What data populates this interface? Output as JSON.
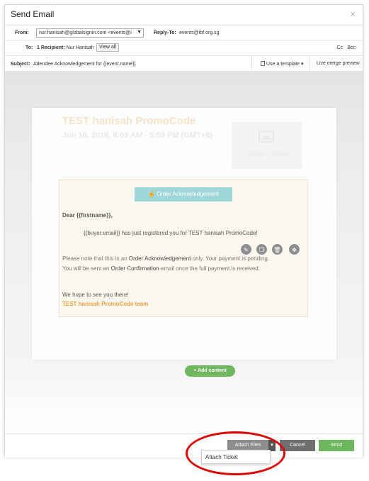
{
  "modal": {
    "title": "Send Email"
  },
  "from": {
    "label": "From:",
    "value": "nur.hanisah@globalsignin.com <events@i",
    "arrow": "▼"
  },
  "reply_to": {
    "label": "Reply-To:",
    "value": "events@ibf.org.sg"
  },
  "to": {
    "label": "To:",
    "count": "1 Recipient:",
    "name": "Nur Hanisah",
    "view_all": "View all",
    "cc": "Cc",
    "bcc": "Bcc"
  },
  "subject": {
    "label": "Subject:",
    "value": "Attendee Acknowledgement for {{event.name}}",
    "use_template": "Use a template ▾",
    "live_preview": "Live merge preview"
  },
  "email": {
    "event_title": "TEST hanisah PromoCode",
    "event_date": "Jun 16, 2018, 8:09 AM - 5:09 PM (GMT+8)",
    "image_size": "150px × 150px",
    "header_button": "Order Acknowledgement",
    "greeting": "Dear {{firstname}},",
    "line1": "{{buyer.email}} has just registered you for TEST hanisah PromoCode!",
    "note1_a": "Please note that this is an ",
    "note1_b": "Order Acknowledgement",
    "note1_c": " only. Your payment is pending.",
    "note2_a": "You will be sent an ",
    "note2_b": "Order Confirmation",
    "note2_c": " email once the full payment is received.",
    "closing": "We hope to see you there!",
    "team": "TEST hanisah PromoCode team"
  },
  "add_content": "+ Add content",
  "footer": {
    "attach_files": "Attach Files",
    "cancel": "Cancel",
    "send": "Send",
    "attach_ticket": "Attach Ticket"
  },
  "colors": {
    "accent_green": "#6fb75f",
    "attach_gray": "#8d8d8d",
    "highlight_red": "#e00000"
  }
}
